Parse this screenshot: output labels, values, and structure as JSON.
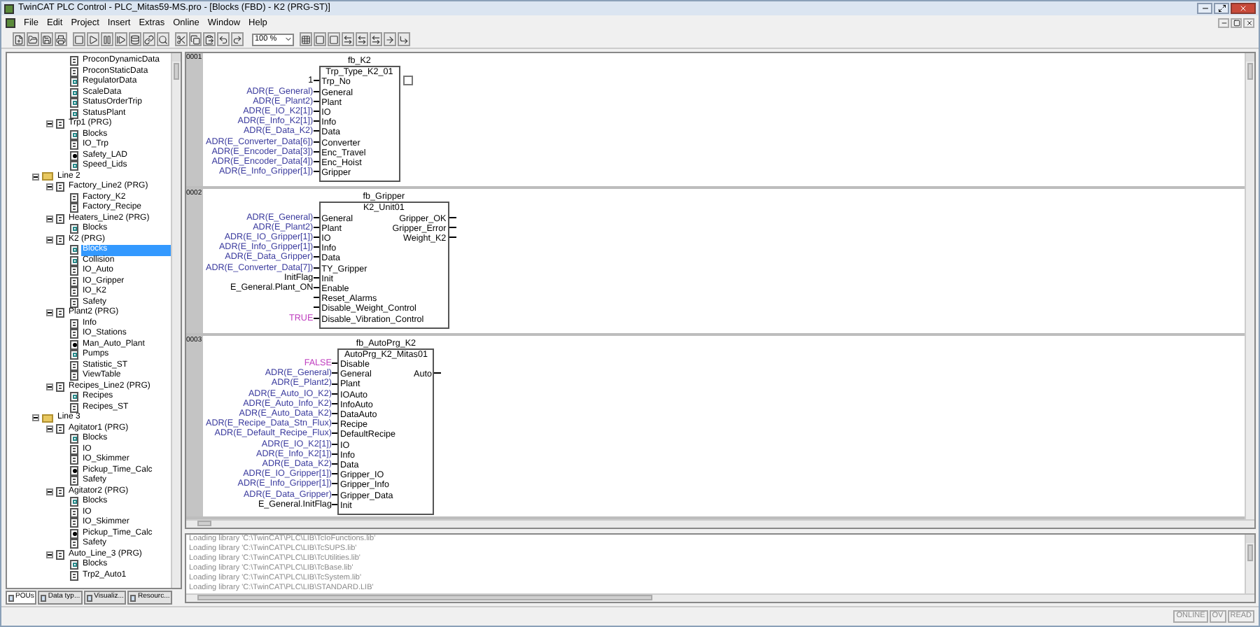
{
  "window": {
    "title": "TwinCAT PLC Control - PLC_Mitas59-MS.pro - [Blocks (FBD) - K2 (PRG-ST)]"
  },
  "menu": [
    "File",
    "Edit",
    "Project",
    "Insert",
    "Extras",
    "Online",
    "Window",
    "Help"
  ],
  "toolbar": {
    "zoom": "100 %"
  },
  "tree": [
    {
      "children": [
        {
          "children": [
            {
              "label": "ProconDynamicData",
              "kind": "program",
              "selected": false
            },
            {
              "label": "ProconStaticData",
              "kind": "program",
              "selected": false
            },
            {
              "label": "RegulatorData",
              "kind": "grid",
              "selected": false
            },
            {
              "label": "ScaleData",
              "kind": "grid",
              "selected": false
            },
            {
              "label": "StatusOrderTrip",
              "kind": "grid",
              "selected": false
            },
            {
              "label": "StatusPlant",
              "kind": "grid",
              "selected": false
            }
          ]
        },
        {
          "label": "Trp1 (PRG)",
          "kind": "program",
          "expanded": true,
          "selected": false,
          "children": [
            {
              "label": "Blocks",
              "kind": "grid",
              "selected": false
            },
            {
              "label": "IO_Trp",
              "kind": "program",
              "selected": false
            },
            {
              "label": "Safety_LAD",
              "kind": "ladder",
              "selected": false
            },
            {
              "label": "Speed_Lids",
              "kind": "grid",
              "selected": false
            }
          ]
        }
      ]
    },
    {
      "label": "Line 2",
      "kind": "folder",
      "expanded": true,
      "selected": false,
      "children": [
        {
          "label": "Factory_Line2 (PRG)",
          "kind": "program",
          "expanded": true,
          "selected": false,
          "children": [
            {
              "label": "Factory_K2",
              "kind": "program",
              "selected": false
            },
            {
              "label": "Factory_Recipe",
              "kind": "program",
              "selected": false
            }
          ]
        },
        {
          "label": "Heaters_Line2 (PRG)",
          "kind": "program",
          "expanded": true,
          "selected": false,
          "children": [
            {
              "label": "Blocks",
              "kind": "grid",
              "selected": false
            }
          ]
        },
        {
          "label": "K2 (PRG)",
          "kind": "program",
          "expanded": true,
          "selected": false,
          "children": [
            {
              "label": "Blocks",
              "kind": "grid",
              "selected": true
            },
            {
              "label": "Collision",
              "kind": "grid",
              "selected": false
            },
            {
              "label": "IO_Auto",
              "kind": "program",
              "selected": false
            },
            {
              "label": "IO_Gripper",
              "kind": "program",
              "selected": false
            },
            {
              "label": "IO_K2",
              "kind": "program",
              "selected": false
            },
            {
              "label": "Safety",
              "kind": "program",
              "selected": false
            }
          ]
        },
        {
          "label": "Plant2 (PRG)",
          "kind": "program",
          "expanded": true,
          "selected": false,
          "children": [
            {
              "label": "Info",
              "kind": "program",
              "selected": false
            },
            {
              "label": "IO_Stations",
              "kind": "program",
              "selected": false
            },
            {
              "label": "Man_Auto_Plant",
              "kind": "ladder",
              "selected": false
            },
            {
              "label": "Pumps",
              "kind": "grid",
              "selected": false
            },
            {
              "label": "Statistic_ST",
              "kind": "program",
              "selected": false
            },
            {
              "label": "ViewTable",
              "kind": "program",
              "selected": false
            }
          ]
        },
        {
          "label": "Recipes_Line2 (PRG)",
          "kind": "program",
          "expanded": true,
          "selected": false,
          "children": [
            {
              "label": "Recipes",
              "kind": "grid",
              "selected": false
            },
            {
              "label": "Recipes_ST",
              "kind": "program",
              "selected": false
            }
          ]
        }
      ]
    },
    {
      "label": "Line 3",
      "kind": "folder",
      "expanded": true,
      "selected": false,
      "children": [
        {
          "label": "Agitator1 (PRG)",
          "kind": "program",
          "expanded": true,
          "selected": false,
          "children": [
            {
              "label": "Blocks",
              "kind": "grid",
              "selected": false
            },
            {
              "label": "IO",
              "kind": "program",
              "selected": false
            },
            {
              "label": "IO_Skimmer",
              "kind": "program",
              "selected": false
            },
            {
              "label": "Pickup_Time_Calc",
              "kind": "ladder",
              "selected": false
            },
            {
              "label": "Safety",
              "kind": "program",
              "selected": false
            }
          ]
        },
        {
          "label": "Agitator2 (PRG)",
          "kind": "program",
          "expanded": true,
          "selected": false,
          "children": [
            {
              "label": "Blocks",
              "kind": "grid",
              "selected": false
            },
            {
              "label": "IO",
              "kind": "program",
              "selected": false
            },
            {
              "label": "IO_Skimmer",
              "kind": "program",
              "selected": false
            },
            {
              "label": "Pickup_Time_Calc",
              "kind": "ladder",
              "selected": false
            },
            {
              "label": "Safety",
              "kind": "program",
              "selected": false
            }
          ]
        },
        {
          "label": "Auto_Line_3 (PRG)",
          "kind": "program",
          "expanded": true,
          "selected": false,
          "children": [
            {
              "label": "Blocks",
              "kind": "grid",
              "selected": false
            },
            {
              "label": "Trp2_Auto1",
              "kind": "program",
              "selected": false
            }
          ]
        }
      ]
    }
  ],
  "tree_tabs": [
    {
      "label": "POUs",
      "selected": true
    },
    {
      "label": "Data typ...",
      "selected": false
    },
    {
      "label": "Visualiz...",
      "selected": false
    },
    {
      "label": "Resourc...",
      "selected": false
    }
  ],
  "networks": [
    {
      "number": "0001",
      "block": {
        "type": "fb_K2",
        "instance": "Trp_Type_K2_01",
        "inputs": [
          {
            "kind": "literal",
            "value": "1",
            "pin": "Trp_No"
          },
          {
            "kind": "address",
            "value": "ADR(E_General)",
            "pin": "General"
          },
          {
            "kind": "address",
            "value": "ADR(E_Plant2)",
            "pin": "Plant"
          },
          {
            "kind": "address",
            "value": "ADR(E_IO_K2[1])",
            "pin": "IO"
          },
          {
            "kind": "address",
            "value": "ADR(E_Info_K2[1])",
            "pin": "Info"
          },
          {
            "kind": "address",
            "value": "ADR(E_Data_K2)",
            "pin": "Data"
          },
          {
            "kind": "address",
            "value": "ADR(E_Converter_Data[6])",
            "pin": "Converter"
          },
          {
            "kind": "address",
            "value": "ADR(E_Encoder_Data[3])",
            "pin": "Enc_Travel"
          },
          {
            "kind": "address",
            "value": "ADR(E_Encoder_Data[4])",
            "pin": "Enc_Hoist"
          },
          {
            "kind": "address",
            "value": "ADR(E_Info_Gripper[1])",
            "pin": "Gripper"
          }
        ],
        "outputs": [
          {
            "kind": "empty_field"
          }
        ]
      }
    },
    {
      "number": "0002",
      "block": {
        "type": "fb_Gripper",
        "instance": "K2_Unit01",
        "inputs": [
          {
            "kind": "address",
            "value": "ADR(E_General)",
            "pin": "General"
          },
          {
            "kind": "address",
            "value": "ADR(E_Plant2)",
            "pin": "Plant"
          },
          {
            "kind": "address",
            "value": "ADR(E_IO_Gripper[1])",
            "pin": "IO"
          },
          {
            "kind": "address",
            "value": "ADR(E_Info_Gripper[1])",
            "pin": "Info"
          },
          {
            "kind": "address",
            "value": "ADR(E_Data_Gripper)",
            "pin": "Data"
          },
          {
            "kind": "address",
            "value": "ADR(E_Converter_Data[7])",
            "pin": "TY_Gripper"
          },
          {
            "kind": "variable",
            "value": "InitFlag",
            "pin": "Init"
          },
          {
            "kind": "variable",
            "value": "E_General.Plant_ON",
            "pin": "Enable"
          },
          {
            "kind": "open",
            "pin": "Reset_Alarms"
          },
          {
            "kind": "open",
            "pin": "Disable_Weight_Control"
          },
          {
            "kind": "boolean",
            "value": "TRUE",
            "pin": "Disable_Vibration_Control"
          }
        ],
        "outputs": [
          {
            "kind": "pin",
            "pin": "Gripper_OK"
          },
          {
            "kind": "pin",
            "pin": "Gripper_Error"
          },
          {
            "kind": "pin",
            "pin": "Weight_K2"
          }
        ]
      }
    },
    {
      "number": "0003",
      "block": {
        "type": "fb_AutoPrg_K2",
        "instance": "AutoPrg_K2_Mitas01",
        "inputs": [
          {
            "kind": "boolean",
            "value": "FALSE",
            "pin": "Disable"
          },
          {
            "kind": "address",
            "value": "ADR(E_General)",
            "pin": "General"
          },
          {
            "kind": "address",
            "value": "ADR(E_Plant2)",
            "pin": "Plant"
          },
          {
            "kind": "address",
            "value": "ADR(E_Auto_IO_K2)",
            "pin": "IOAuto"
          },
          {
            "kind": "address",
            "value": "ADR(E_Auto_Info_K2)",
            "pin": "InfoAuto"
          },
          {
            "kind": "address",
            "value": "ADR(E_Auto_Data_K2)",
            "pin": "DataAuto"
          },
          {
            "kind": "address",
            "value": "ADR(E_Recipe_Data_Stn_Flux)",
            "pin": "Recipe"
          },
          {
            "kind": "address",
            "value": "ADR(E_Default_Recipe_Flux)",
            "pin": "DefaultRecipe"
          },
          {
            "kind": "address",
            "value": "ADR(E_IO_K2[1])",
            "pin": "IO"
          },
          {
            "kind": "address",
            "value": "ADR(E_Info_K2[1])",
            "pin": "Info"
          },
          {
            "kind": "address",
            "value": "ADR(E_Data_K2)",
            "pin": "Data"
          },
          {
            "kind": "address",
            "value": "ADR(E_IO_Gripper[1])",
            "pin": "Gripper_IO"
          },
          {
            "kind": "address",
            "value": "ADR(E_Info_Gripper[1])",
            "pin": "Gripper_Info"
          },
          {
            "kind": "address",
            "value": "ADR(E_Data_Gripper)",
            "pin": "Gripper_Data"
          },
          {
            "kind": "variable",
            "value": "E_General.InitFlag",
            "pin": "Init"
          }
        ],
        "outputs": [
          {
            "kind": "empty"
          },
          {
            "kind": "pin",
            "pin": "Auto"
          }
        ]
      }
    }
  ],
  "log": [
    "Loading library 'C:\\TwinCAT\\PLC\\LIB\\TcIoFunctions.lib'",
    "Loading library 'C:\\TwinCAT\\PLC\\LIB\\TcSUPS.lib'",
    "Loading library 'C:\\TwinCAT\\PLC\\LIB\\TcUtilities.lib'",
    "Loading library 'C:\\TwinCAT\\PLC\\LIB\\TcBase.lib'",
    "Loading library 'C:\\TwinCAT\\PLC\\LIB\\TcSystem.lib'",
    "Loading library 'C:\\TwinCAT\\PLC\\LIB\\STANDARD.LIB'"
  ],
  "status_bar": [
    "ONLINE",
    "OV",
    "READ"
  ]
}
